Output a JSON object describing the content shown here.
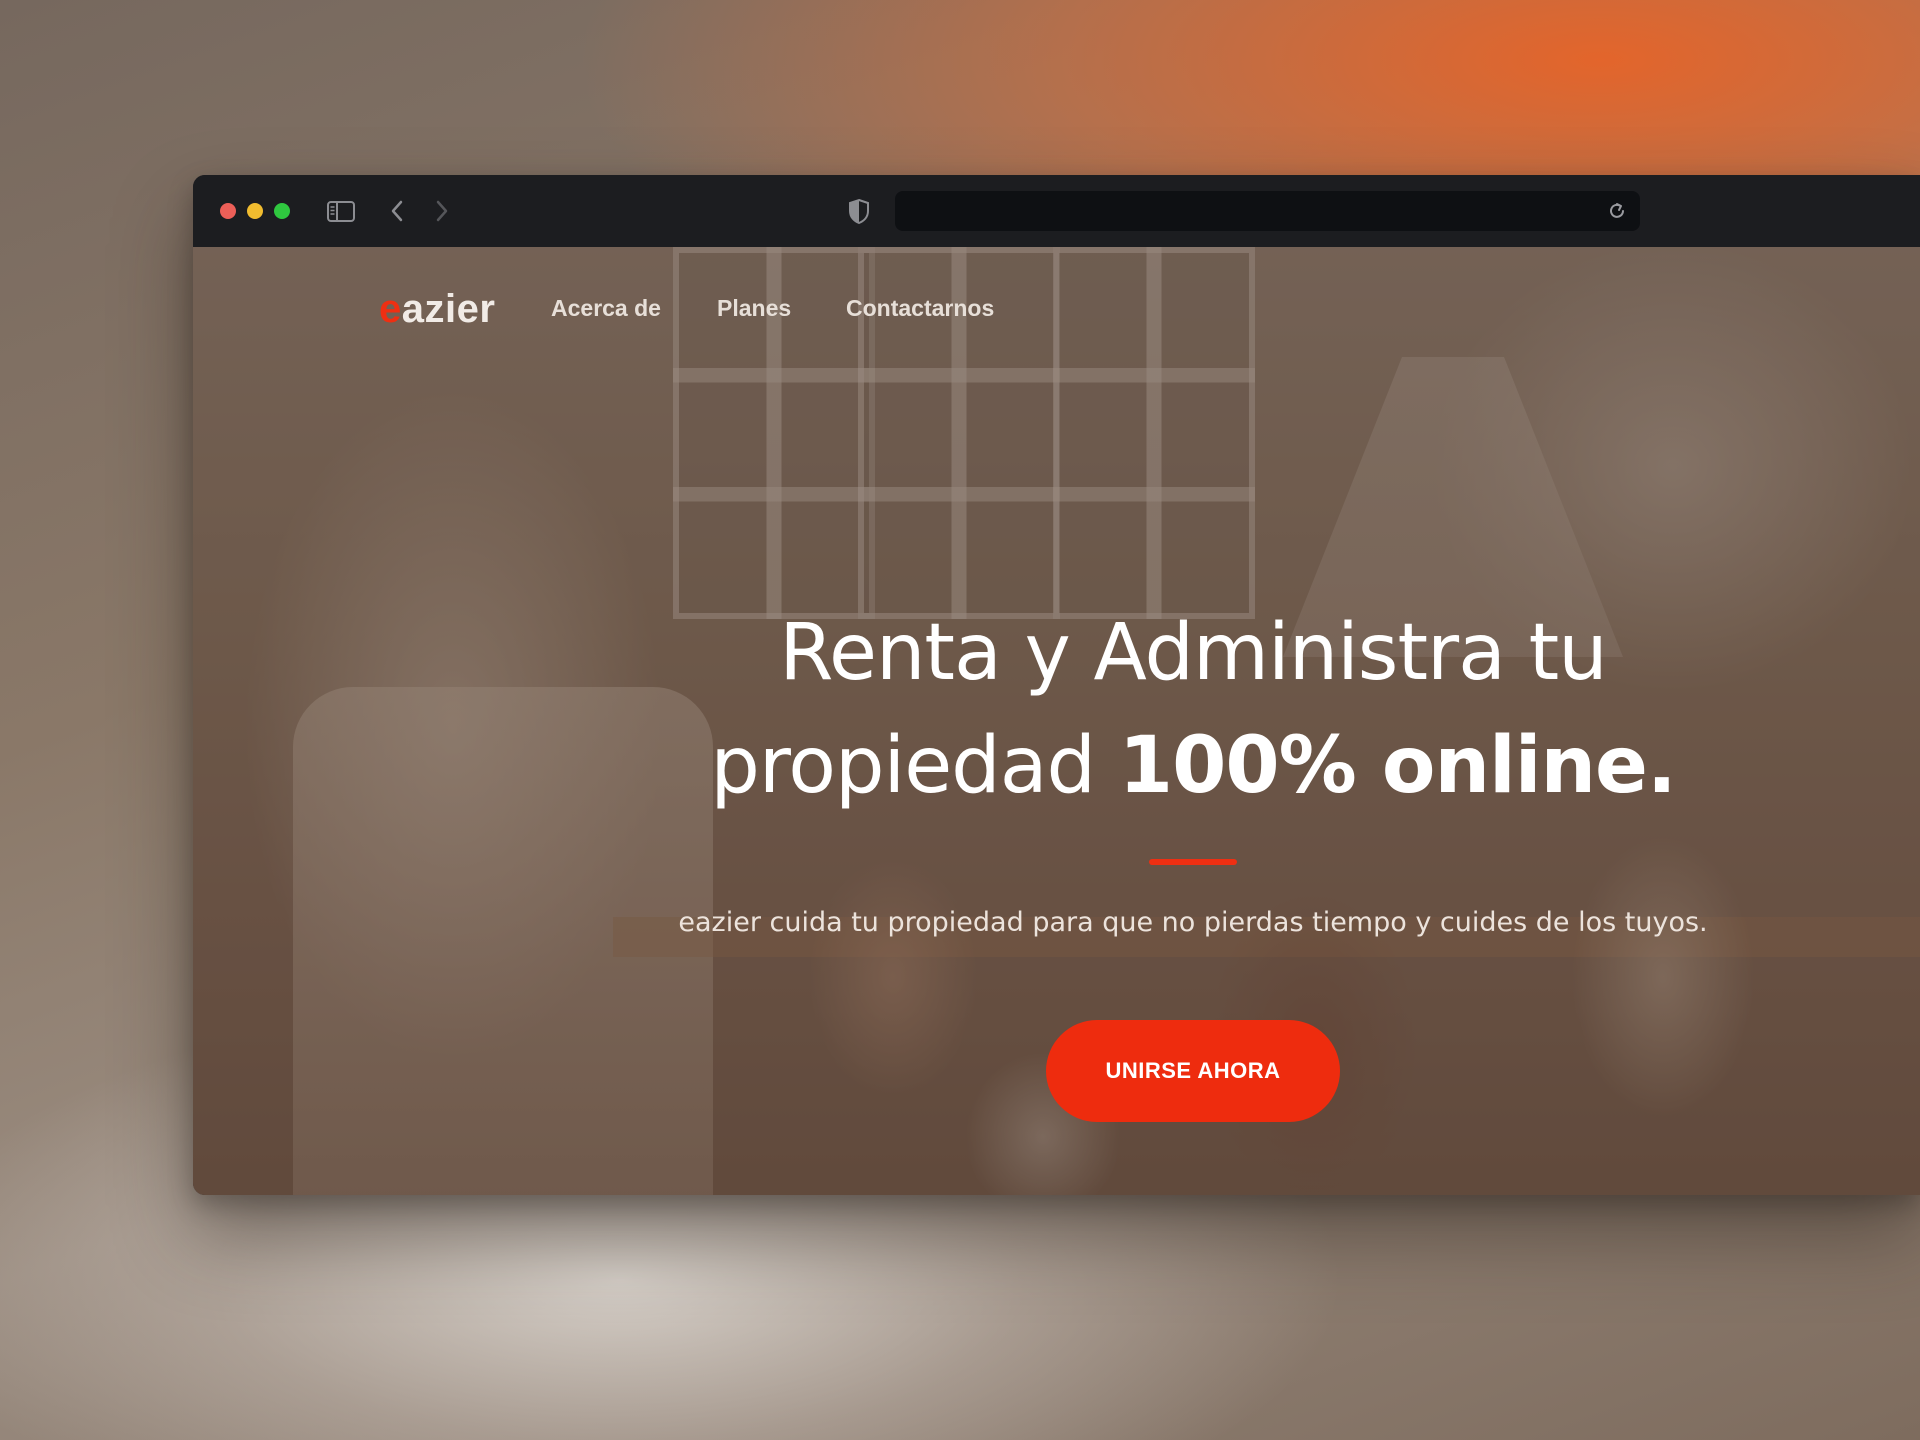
{
  "brand": {
    "logo_accent": "e",
    "logo_rest": "azier",
    "accent_color": "#ee2f12"
  },
  "browser": {
    "controls": [
      "close",
      "minimize",
      "zoom"
    ],
    "icons": [
      "sidebar-icon",
      "back-icon",
      "forward-icon",
      "shield-icon",
      "reload-icon"
    ],
    "address": ""
  },
  "nav": {
    "items": [
      {
        "label": "Acerca de"
      },
      {
        "label": "Planes"
      },
      {
        "label": "Contactarnos"
      }
    ]
  },
  "hero": {
    "title_part1": "Renta y Administra tu propiedad ",
    "title_bold": "100% online.",
    "subtitle": "eazier cuida tu propiedad para que no pierdas tiempo y cuides de los tuyos.",
    "cta_label": "UNIRSE AHORA"
  }
}
